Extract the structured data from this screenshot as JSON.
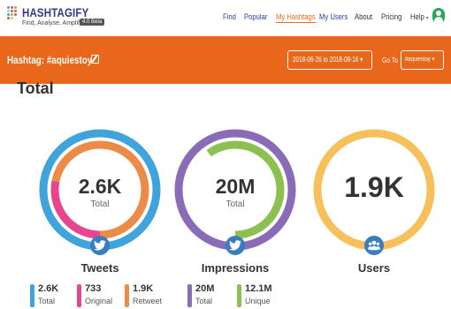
{
  "header": {
    "logo_title": "HASHTAGIFY",
    "logo_tagline": "Find, Analyse, Amplify",
    "logo_badge": "4.0 Beta",
    "nav": [
      {
        "label": "Find"
      },
      {
        "label": "Popular"
      },
      {
        "label": "My Hashtags"
      },
      {
        "label": "My Users"
      },
      {
        "label": "About"
      },
      {
        "label": "Pricing"
      },
      {
        "label": "Help"
      }
    ]
  },
  "hashtag_bar": {
    "title": "Hashtag: #aquiestoy",
    "date_range": "2018-06-26 to 2018-08-16",
    "goto_label": "Go To",
    "goto_value": "#aquiestoy"
  },
  "section": {
    "title": "Total"
  },
  "colors": {
    "orange": "#e8671a",
    "blue": "#3fa4db",
    "pink": "#e8458e",
    "orange_ring": "#ec8a47",
    "purple": "#8a6bb8",
    "green": "#8cc152",
    "yellow": "#f8c05a",
    "nav_blue": "#2b3ea0"
  },
  "stats": {
    "tweets": {
      "name": "Tweets",
      "value": "2.6K",
      "sub": "Total",
      "icon": "twitter-icon",
      "original_share": 0.28,
      "retweet_share": 0.72
    },
    "impressions": {
      "name": "Impressions",
      "value": "20M",
      "sub": "Total",
      "icon": "twitter-icon",
      "unique_share": 0.6
    },
    "users": {
      "name": "Users",
      "value": "1.9K",
      "icon": "users-icon"
    }
  },
  "breakdown": [
    {
      "value": "2.6K",
      "label": "Total",
      "color": "#3fa4db"
    },
    {
      "value": "733",
      "label": "Original",
      "color": "#e8458e"
    },
    {
      "value": "1.9K",
      "label": "Retweet",
      "color": "#ec8a47"
    },
    {
      "value": "20M",
      "label": "Total",
      "color": "#8a6bb8"
    },
    {
      "value": "12.1M",
      "label": "Unique",
      "color": "#8cc152"
    }
  ]
}
